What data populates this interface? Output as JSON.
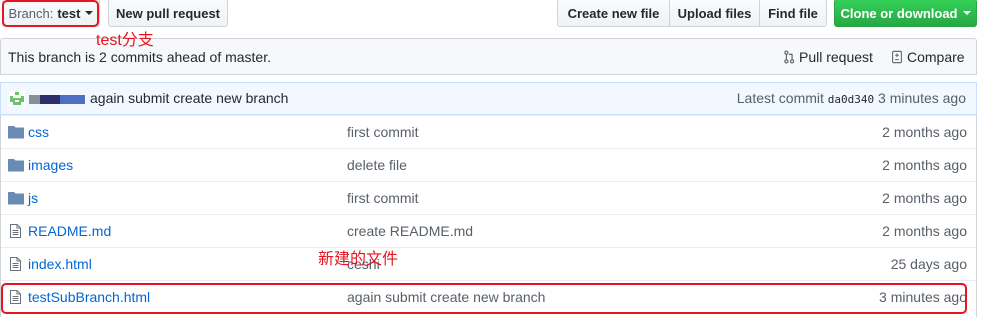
{
  "toolbar": {
    "branch_label": "Branch:",
    "branch_value": "test",
    "new_pull_request": "New pull request",
    "create_new_file": "Create new file",
    "upload_files": "Upload files",
    "find_file": "Find file",
    "clone_or_download": "Clone or download"
  },
  "annotations": {
    "branch_note": "test分支",
    "new_file_note": "新建的文件",
    "color": "#e8141f"
  },
  "branch_info": {
    "text": "This branch is 2 commits ahead of master.",
    "pull_request": "Pull request",
    "compare": "Compare"
  },
  "latest_commit": {
    "message": "again submit create new branch",
    "label": "Latest commit",
    "sha": "da0d340",
    "age": "3 minutes ago"
  },
  "files": [
    {
      "type": "folder",
      "icon": "folder-icon",
      "name": "css",
      "message": "first commit",
      "age": "2 months ago"
    },
    {
      "type": "folder",
      "icon": "folder-icon",
      "name": "images",
      "message": "delete file",
      "age": "2 months ago"
    },
    {
      "type": "folder",
      "icon": "folder-icon",
      "name": "js",
      "message": "first commit",
      "age": "2 months ago"
    },
    {
      "type": "file",
      "icon": "file-icon",
      "name": "README.md",
      "message": "create README.md",
      "age": "2 months ago"
    },
    {
      "type": "file",
      "icon": "file-icon",
      "name": "index.html",
      "message": "ceshi",
      "age": "25 days ago"
    },
    {
      "type": "file",
      "icon": "file-icon",
      "name": "testSubBranch.html",
      "message": "again submit create new branch",
      "age": "3 minutes ago"
    }
  ],
  "colors": {
    "link": "#0366d6",
    "clone_button": "#28a745",
    "commit_bar_bg": "#f1f8ff"
  }
}
